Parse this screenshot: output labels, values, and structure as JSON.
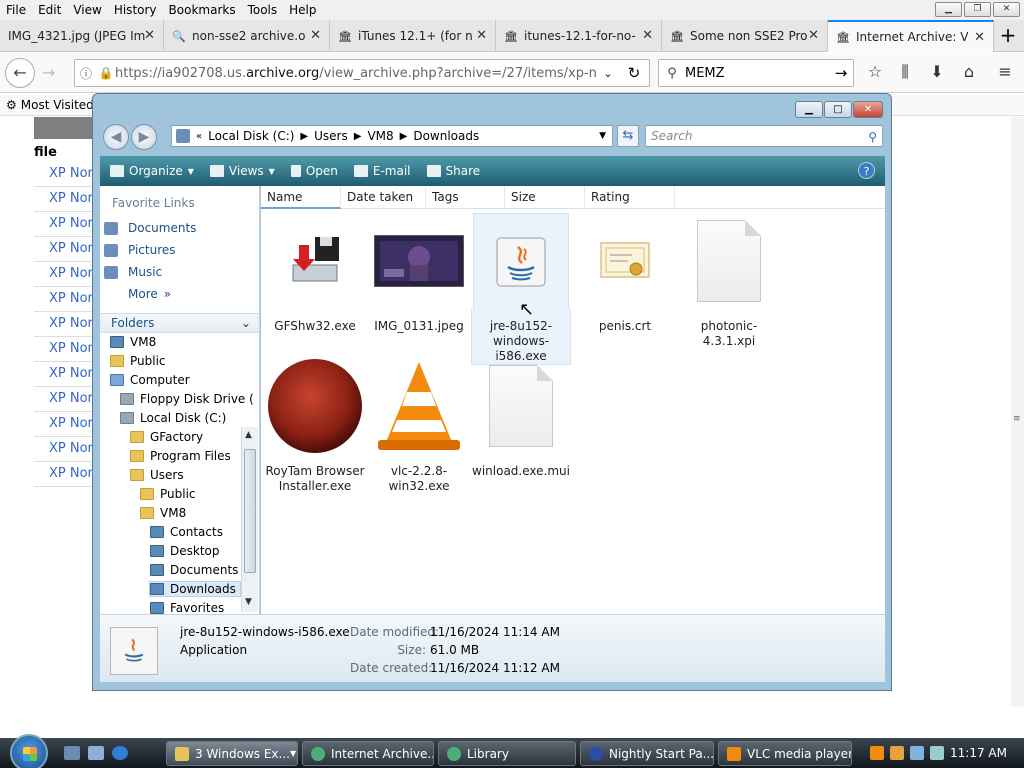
{
  "menu": [
    "File",
    "Edit",
    "View",
    "History",
    "Bookmarks",
    "Tools",
    "Help"
  ],
  "tabs": [
    {
      "title": "IMG_4321.jpg (JPEG Im",
      "icon": "image-icon"
    },
    {
      "title": "non-sse2 archive.o",
      "icon": "search-icon"
    },
    {
      "title": "iTunes 12.1+ (for n",
      "icon": "archive-icon"
    },
    {
      "title": "itunes-12.1-for-no-",
      "icon": "archive-icon"
    },
    {
      "title": "Some non SSE2 Pro",
      "icon": "archive-icon"
    },
    {
      "title": "Internet Archive: V",
      "icon": "archive-icon"
    }
  ],
  "nav": {
    "url_prefix": "https://ia902708.us.",
    "url_domain": "archive.org",
    "url_suffix": "/view_archive.php?archive=/27/items/xp-nor",
    "search_value": "MEMZ"
  },
  "bookmarks": {
    "label": "Most Visited"
  },
  "page": {
    "file_header": "file",
    "rows": [
      "XP Nor",
      "XP Nor",
      "XP Nor",
      "XP Nor",
      "XP Nor",
      "XP Nor",
      "XP Nor",
      "XP Nor",
      "XP Nor",
      "XP Nor",
      "XP Nor",
      "XP Nor",
      "XP Nor"
    ]
  },
  "explorer": {
    "path": [
      "Local Disk (C:)",
      "Users",
      "VM8",
      "Downloads"
    ],
    "search_placeholder": "Search",
    "commands": [
      "Organize",
      "Views",
      "Open",
      "E-mail",
      "Share"
    ],
    "favorite_links_header": "Favorite Links",
    "favorite_links": [
      "Documents",
      "Pictures",
      "Music"
    ],
    "more_label": "More",
    "folders_header": "Folders",
    "tree": [
      {
        "label": "VM8",
        "indent": 0,
        "type": "blue"
      },
      {
        "label": "Public",
        "indent": 0,
        "type": "folder"
      },
      {
        "label": "Computer",
        "indent": 0,
        "type": "comp"
      },
      {
        "label": "Floppy Disk Drive (",
        "indent": 1,
        "type": "drv"
      },
      {
        "label": "Local Disk (C:)",
        "indent": 1,
        "type": "drv"
      },
      {
        "label": "GFactory",
        "indent": 2,
        "type": "folder"
      },
      {
        "label": "Program Files",
        "indent": 2,
        "type": "folder"
      },
      {
        "label": "Users",
        "indent": 2,
        "type": "folder"
      },
      {
        "label": "Public",
        "indent": 3,
        "type": "folder"
      },
      {
        "label": "VM8",
        "indent": 3,
        "type": "folder"
      },
      {
        "label": "Contacts",
        "indent": 4,
        "type": "blue"
      },
      {
        "label": "Desktop",
        "indent": 4,
        "type": "blue"
      },
      {
        "label": "Documents",
        "indent": 4,
        "type": "blue"
      },
      {
        "label": "Downloads",
        "indent": 4,
        "type": "blue",
        "selected": true
      },
      {
        "label": "Favorites",
        "indent": 4,
        "type": "blue"
      }
    ],
    "columns": [
      "Name",
      "Date taken",
      "Tags",
      "Size",
      "Rating"
    ],
    "files": [
      {
        "name": "GFShw32.exe",
        "kind": "installer-icon"
      },
      {
        "name": "IMG_0131.jpeg",
        "kind": "photo-thumbnail"
      },
      {
        "name": "jre-8u152-windows-i586.exe",
        "kind": "java-icon",
        "selected": true
      },
      {
        "name": "penis.crt",
        "kind": "certificate-icon"
      },
      {
        "name": "photonic-4.3.1.xpi",
        "kind": "document-icon"
      },
      {
        "name": "RoyTam Browser Installer.exe",
        "kind": "red-orb-icon"
      },
      {
        "name": "vlc-2.2.8-win32.exe",
        "kind": "vlc-cone-icon"
      },
      {
        "name": "winload.exe.mui",
        "kind": "document-icon"
      }
    ],
    "details": {
      "name": "jre-8u152-windows-i586.exe",
      "type": "Application",
      "date_modified_label": "Date modified:",
      "date_modified": "11/16/2024 11:14 AM",
      "size_label": "Size:",
      "size": "61.0 MB",
      "date_created_label": "Date created:",
      "date_created": "11/16/2024 11:12 AM"
    }
  },
  "taskbar": {
    "items": [
      "3 Windows Ex...",
      "Internet Archive...",
      "Library",
      "Nightly Start Pa...",
      "VLC media player"
    ],
    "clock": "11:17 AM"
  },
  "colors": {
    "accent": "#0a84ff",
    "link": "#3366cc",
    "command_bar": "#1f5d72"
  }
}
